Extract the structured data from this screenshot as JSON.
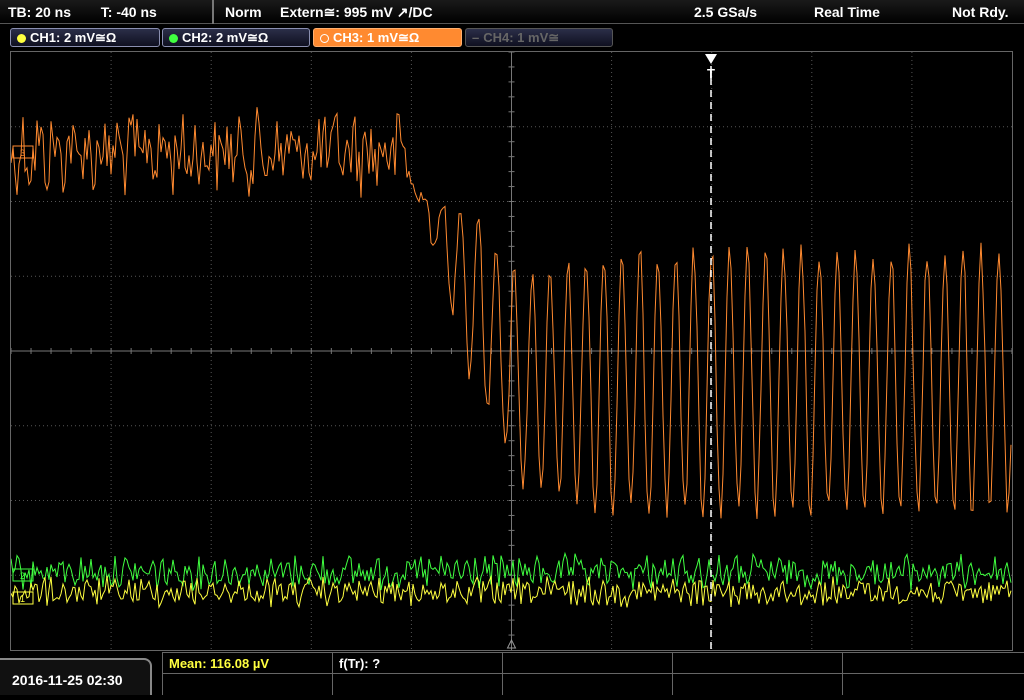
{
  "topbar": {
    "tb": "TB: 20 ns",
    "t": "T: -40 ns",
    "mode": "Norm",
    "trigger": "Extern≅: 995 mV ↗/DC",
    "samplerate": "2.5 GSa/s",
    "acq": "Real Time",
    "status": "Not Rdy."
  },
  "channels": [
    {
      "label": "CH1: 2 mV≅Ω",
      "color": "#ffff40"
    },
    {
      "label": "CH2: 2 mV≅Ω",
      "color": "#40ff40"
    },
    {
      "label": "CH3: 1 mV≅Ω",
      "color": "#ff8a30"
    },
    {
      "label": "CH4: 1 mV≅",
      "color": "#666666"
    }
  ],
  "markers": {
    "ch3": "3",
    "ch2": "2",
    "ch1": "1",
    "trigger": "T"
  },
  "bottom": {
    "date": "2016-11-25 02:30",
    "mean": "Mean: 116.08 µV",
    "ftr": "f(Tr): ?"
  },
  "colors": {
    "ch1": "#ffff40",
    "ch2": "#40ff40",
    "ch3": "#ff8a30",
    "grid": "#555555"
  }
}
